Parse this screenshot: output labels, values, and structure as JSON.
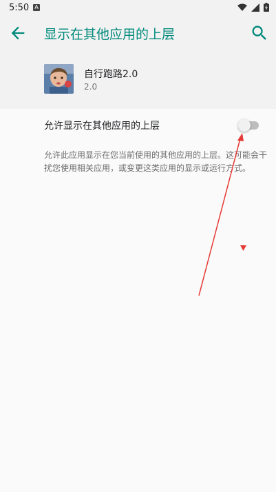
{
  "status_bar": {
    "time": "5:50",
    "notification_letter": "A"
  },
  "toolbar": {
    "title": "显示在其他应用的上层"
  },
  "app": {
    "name": "自行跑路2.0",
    "version": "2.0"
  },
  "setting": {
    "label": "允许显示在其他应用的上层",
    "enabled": false,
    "description": "允许此应用显示在您当前使用的其他应用的上层。这可能会干扰您使用相关应用，或变更这类应用的显示或运行方式。"
  },
  "colors": {
    "accent": "#00897b",
    "annotation": "#e53935"
  },
  "icons": [
    "back-arrow-icon",
    "search-icon",
    "wifi-icon",
    "signal-icon",
    "battery-icon"
  ]
}
